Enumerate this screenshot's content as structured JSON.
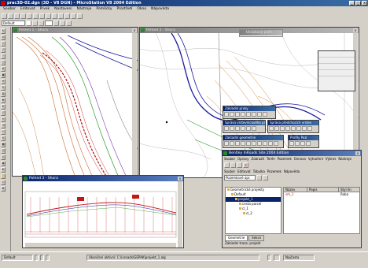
{
  "app": {
    "title": "prac3D-02.dgn (3D - V8 DGN) - MicroStation V8 2004 Edition"
  },
  "menu": [
    "Soubor",
    "Editovat",
    "Prvek",
    "Nastavení",
    "Nástroje",
    "Pomůcky",
    "Prostředí",
    "Okno",
    "Nápověda"
  ],
  "level_combo": {
    "value": "Default"
  },
  "views": {
    "view1": {
      "title": "Pohled 1 - Shora"
    },
    "view2": {
      "title": "Pohled 2 - Shora"
    },
    "view3": {
      "title": "Pohled 3 - Shora"
    },
    "view_float": {
      "title": "Ukázkový pohl."
    }
  },
  "toolboxes": {
    "t1": {
      "title": "Základní prvky"
    },
    "t2": {
      "title": "Správa vrstevnicového plánu"
    },
    "t3": {
      "title": "Správa předchozích vrstev"
    },
    "t4": {
      "title": "Základní geometrie"
    },
    "t5": {
      "title": "Profily Pozi"
    }
  },
  "geopak": {
    "title": "Bentley InRoads Site 2004 Edition",
    "menu": [
      "Soubor",
      "Úpravy",
      "Zobrazit",
      "Terén",
      "Pozemek",
      "Osnova",
      "Vytvoření",
      "Výkres",
      "Nástroje"
    ],
    "menu2": [
      "Soubor",
      "Editovat",
      "Tabulka",
      "Pozemek",
      "Nápověda"
    ],
    "combo": "Pozemkové úpr.",
    "tree": [
      {
        "label": "Geometrické projekty",
        "indent": 0,
        "selected": false
      },
      {
        "label": "Default",
        "indent": 1,
        "selected": false
      },
      {
        "label": "projekt_1",
        "indent": 2,
        "selected": true
      },
      {
        "label": "cesta parcel",
        "indent": 3,
        "selected": false
      },
      {
        "label": "cl_1",
        "indent": 3,
        "selected": false
      },
      {
        "label": "cl_2",
        "indent": 4,
        "selected": false
      }
    ],
    "list_headers": [
      "Název",
      "Popis",
      "Styl lín"
    ],
    "list_rows": [
      {
        "name": "sm_1",
        "desc": "",
        "style": "Roba"
      }
    ],
    "right_col": [
      "Roba",
      "Roba"
    ],
    "tabs": [
      "Geometrie",
      "Sekce"
    ],
    "status": "Základní trasa: projekt"
  },
  "status": {
    "prompt": "Ukončení aktivní: C:\\inroads\\GEPAK\\projekt_1.alg",
    "view": "Default",
    "right": "Najčasto"
  }
}
